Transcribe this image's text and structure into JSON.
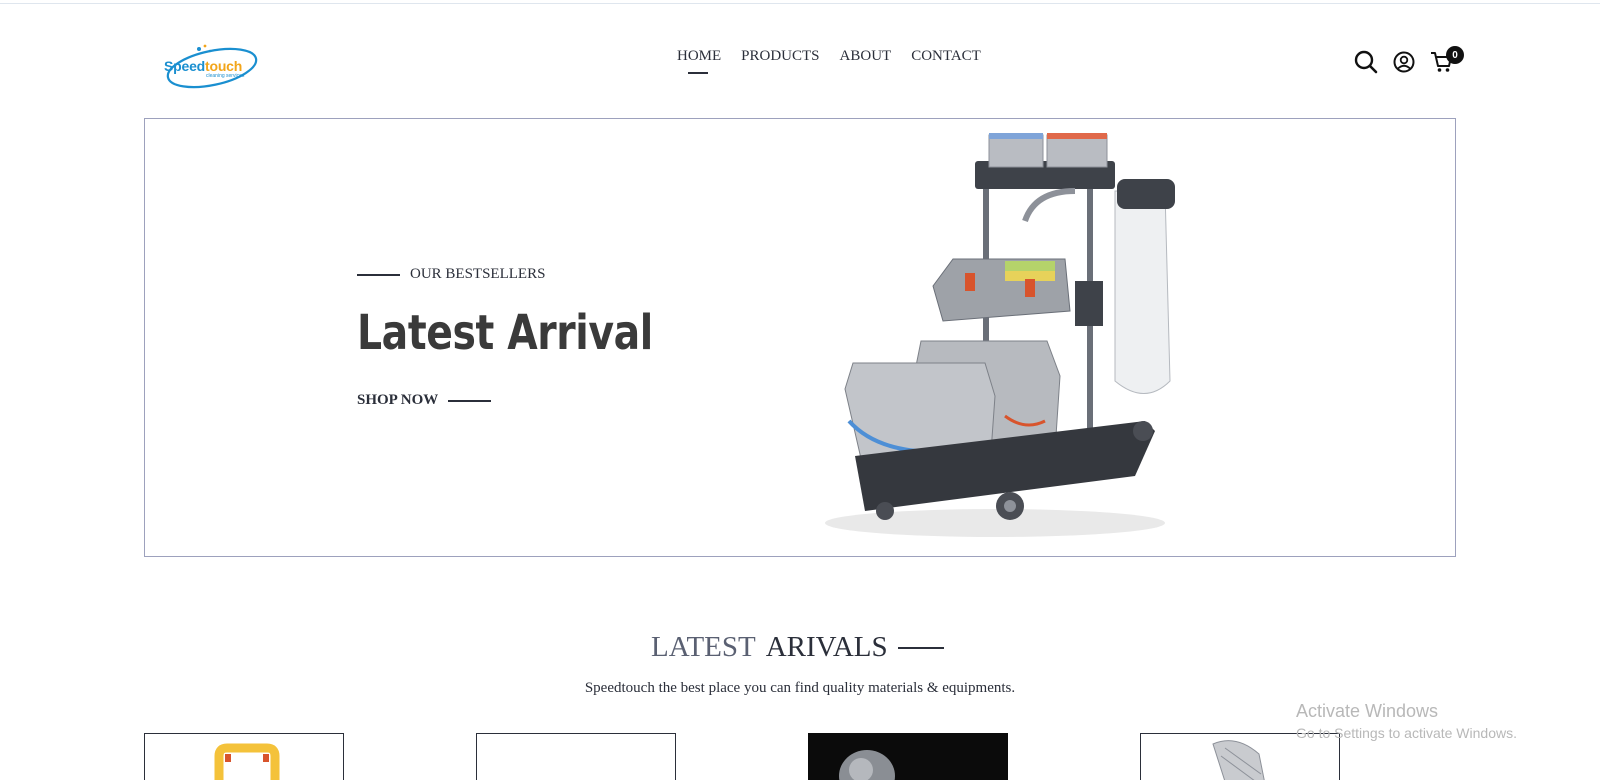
{
  "logo": {
    "part1": "Speed",
    "part2": "touch",
    "tagline": "cleaning services"
  },
  "nav": {
    "items": [
      "HOME",
      "PRODUCTS",
      "ABOUT",
      "CONTACT"
    ],
    "active": "HOME"
  },
  "header_icons": [
    "search-icon",
    "user-icon",
    "cart-icon"
  ],
  "cart": {
    "count": "0"
  },
  "hero": {
    "eyebrow": "OUR BESTSELLERS",
    "title": "Latest Arrival",
    "cta": "SHOP NOW"
  },
  "latest": {
    "title_word1": "LATEST",
    "title_word2": "ARIVALS",
    "subtitle": "Speedtouch the best place you can find quality materials & equipments."
  },
  "watermark": {
    "line1": "Activate Windows",
    "line2": "Go to Settings to activate Windows."
  },
  "colors": {
    "text": "#2b2f3a",
    "accent_blue": "#1a8fd0",
    "accent_yellow": "#f2a51a",
    "hero_border": "#9da1bd"
  }
}
